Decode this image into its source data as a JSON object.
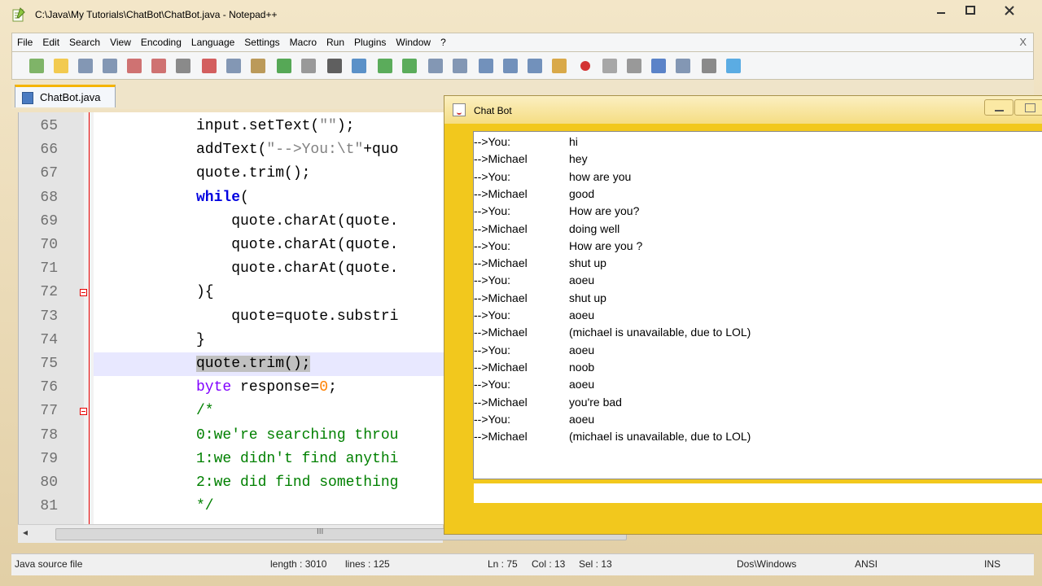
{
  "window": {
    "title": "C:\\Java\\My Tutorials\\ChatBot\\ChatBot.java - Notepad++"
  },
  "menu": [
    "File",
    "Edit",
    "Search",
    "View",
    "Encoding",
    "Language",
    "Settings",
    "Macro",
    "Run",
    "Plugins",
    "Window",
    "?"
  ],
  "menu_close": "X",
  "tab": {
    "label": "ChatBot.java"
  },
  "editor": {
    "lines": [
      {
        "n": "65",
        "code": [
          {
            "t": "input.setText("
          },
          {
            "t": "\"\"",
            "c": "str"
          },
          {
            "t": ");"
          }
        ]
      },
      {
        "n": "66",
        "code": [
          {
            "t": "addText("
          },
          {
            "t": "\"-->You:\\t\"",
            "c": "str"
          },
          {
            "t": "+quo"
          }
        ]
      },
      {
        "n": "67",
        "code": [
          {
            "t": "quote.trim();"
          }
        ]
      },
      {
        "n": "68",
        "code": [
          {
            "t": "while",
            "c": "kw"
          },
          {
            "t": "("
          }
        ]
      },
      {
        "n": "69",
        "code": [
          {
            "t": "    quote.charAt(quote."
          }
        ]
      },
      {
        "n": "70",
        "code": [
          {
            "t": "    quote.charAt(quote."
          }
        ]
      },
      {
        "n": "71",
        "code": [
          {
            "t": "    quote.charAt(quote."
          }
        ]
      },
      {
        "n": "72",
        "code": [
          {
            "t": "){"
          }
        ]
      },
      {
        "n": "73",
        "code": [
          {
            "t": "    quote=quote.substri"
          }
        ]
      },
      {
        "n": "74",
        "code": [
          {
            "t": "}"
          }
        ]
      },
      {
        "n": "75",
        "code": [
          {
            "t": "quote.trim();",
            "c": "sel"
          }
        ]
      },
      {
        "n": "76",
        "code": [
          {
            "t": "byte",
            "c": "ty"
          },
          {
            "t": " response="
          },
          {
            "t": "0",
            "c": "numl"
          },
          {
            "t": ";"
          }
        ]
      },
      {
        "n": "77",
        "code": [
          {
            "t": "/*",
            "c": "cm"
          }
        ]
      },
      {
        "n": "78",
        "code": [
          {
            "t": "0:we're searching throu",
            "c": "cm"
          }
        ]
      },
      {
        "n": "79",
        "code": [
          {
            "t": "1:we didn't find anythi",
            "c": "cm"
          }
        ]
      },
      {
        "n": "80",
        "code": [
          {
            "t": "2:we did find something",
            "c": "cm"
          }
        ]
      },
      {
        "n": "81",
        "code": [
          {
            "t": "*/",
            "c": "cm"
          }
        ]
      }
    ],
    "hscroll_arrow": "◂",
    "hscroll_grip": "III"
  },
  "status": {
    "type": "Java source file",
    "length": "length : 3010",
    "lines": "lines : 125",
    "ln": "Ln : 75",
    "col": "Col : 13",
    "sel": "Sel : 13",
    "eol": "Dos\\Windows",
    "enc": "ANSI",
    "mode": "INS"
  },
  "chatbot": {
    "title": "Chat Bot",
    "messages": [
      {
        "s": "-->You:",
        "t": "hi"
      },
      {
        "s": "-->Michael",
        "t": "hey"
      },
      {
        "s": "-->You:",
        "t": "how are you"
      },
      {
        "s": "-->Michael",
        "t": "good"
      },
      {
        "s": "-->You:",
        "t": "How are you?"
      },
      {
        "s": "-->Michael",
        "t": "doing well"
      },
      {
        "s": "-->You:",
        "t": "How are you ?"
      },
      {
        "s": "-->Michael",
        "t": "shut up"
      },
      {
        "s": "-->You:",
        "t": "aoeu"
      },
      {
        "s": "-->Michael",
        "t": "shut up"
      },
      {
        "s": "-->You:",
        "t": "aoeu"
      },
      {
        "s": "-->Michael",
        "t": "(michael is unavailable, due to LOL)"
      },
      {
        "s": "-->You:",
        "t": "aoeu"
      },
      {
        "s": "-->Michael",
        "t": "noob"
      },
      {
        "s": "-->You:",
        "t": "aoeu"
      },
      {
        "s": "-->Michael",
        "t": "you're bad"
      },
      {
        "s": "-->You:",
        "t": "aoeu"
      },
      {
        "s": "-->Michael",
        "t": "(michael is unavailable, due to LOL)"
      }
    ],
    "input_value": ""
  },
  "toolbar_icons": [
    "new-file-icon",
    "open-file-icon",
    "save-icon",
    "save-all-icon",
    "close-icon",
    "close-all-icon",
    "print-icon",
    "cut-icon",
    "copy-icon",
    "paste-icon",
    "undo-icon",
    "redo-icon",
    "find-icon",
    "replace-icon",
    "zoom-in-icon",
    "zoom-out-icon",
    "sync-vertical-icon",
    "sync-horizontal-icon",
    "word-wrap-icon",
    "show-all-chars-icon",
    "indent-guide-icon",
    "user-lang-icon",
    "record-macro-icon",
    "stop-record-icon",
    "play-macro-icon",
    "run-macro-multiple-icon",
    "save-macro-icon",
    "launch-browser-icon",
    "spellcheck-icon"
  ]
}
